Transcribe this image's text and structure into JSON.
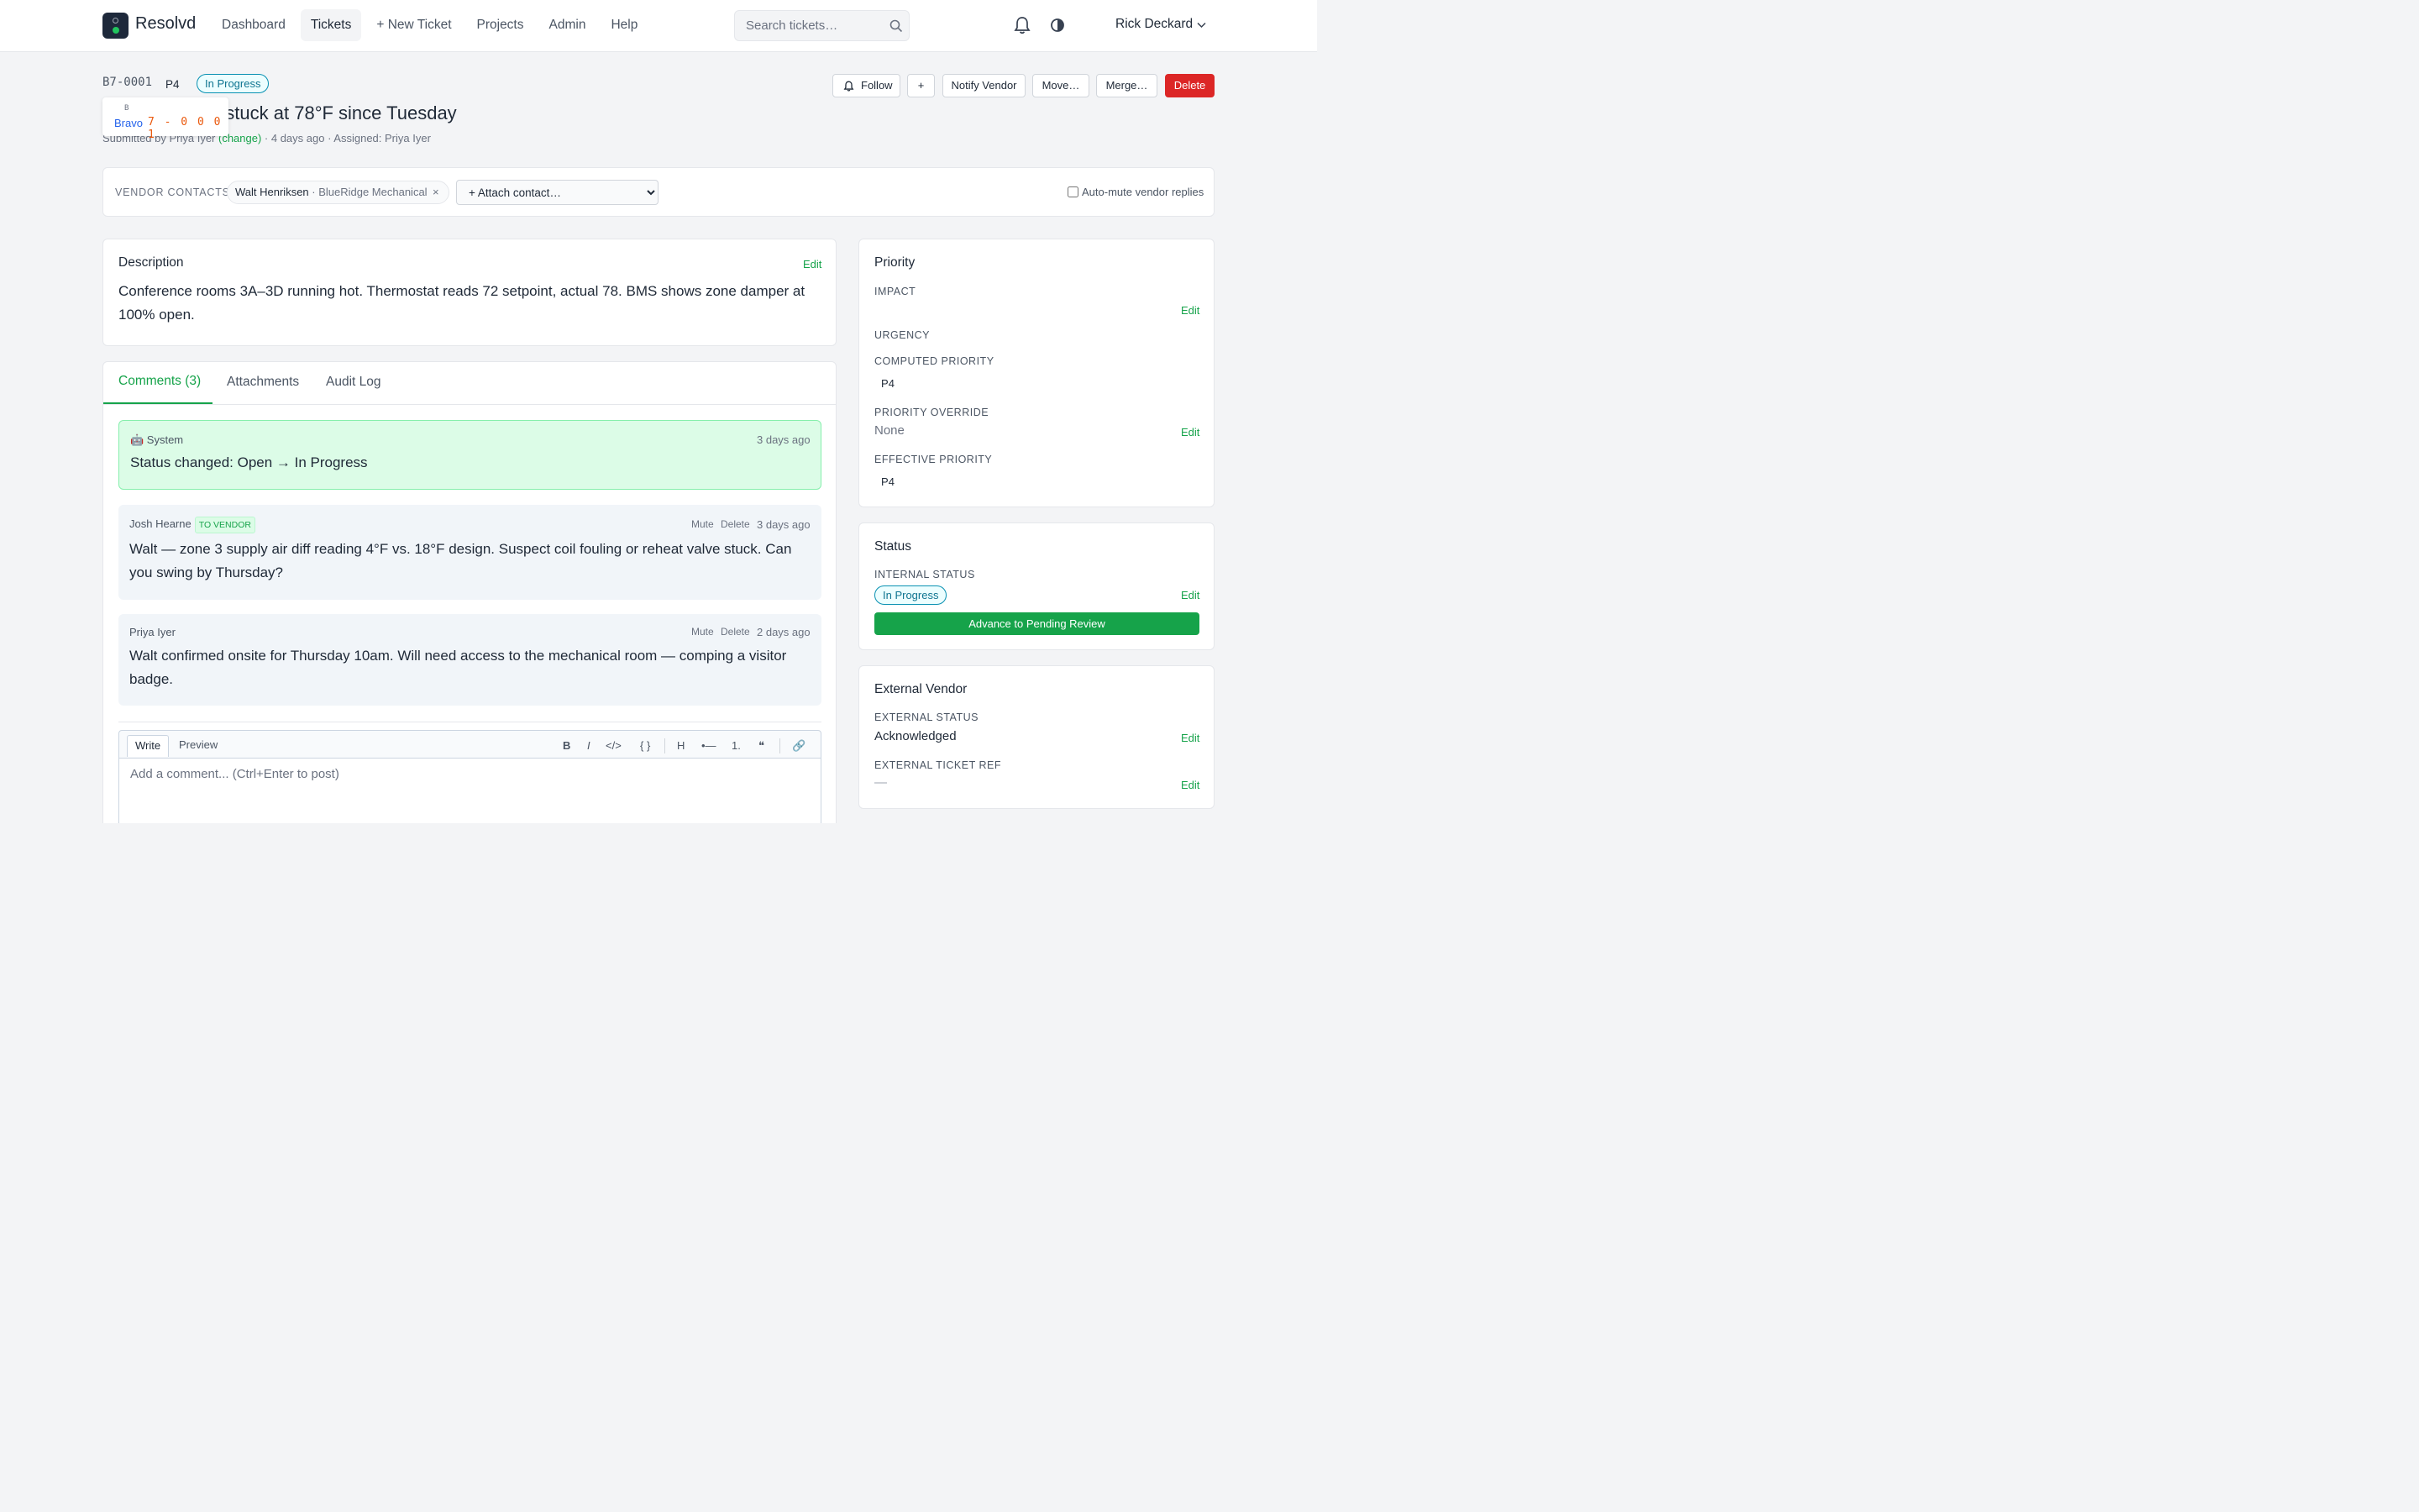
{
  "app": {
    "brand": "Resolvd",
    "user": "Rick Deckard"
  },
  "nav": {
    "links": [
      "Dashboard",
      "Tickets",
      "+ New Ticket",
      "Projects",
      "Admin",
      "Help"
    ]
  },
  "search": {
    "placeholder": "Search tickets…"
  },
  "ticket": {
    "id": "B7-0001",
    "priority": "P4",
    "status": "In Progress",
    "title": "HVAC damper stuck at 78°F since Tuesday",
    "submitted_prefix": "Submitted by Priya Iyer ",
    "change_label": "(change)",
    "submitted_suffix": " · 4 days ago · Assigned: Priya Iyer"
  },
  "tooltip": {
    "line1": "B",
    "word": "Bravo",
    "code": "7 - 0 0 0 1"
  },
  "actions": {
    "follow": "Follow",
    "plus": "+",
    "notify": "Notify Vendor",
    "move": "Move…",
    "merge": "Merge…",
    "delete": "Delete"
  },
  "vendor_contacts": {
    "label": "VENDOR CONTACTS",
    "chip_name": "Walt Henriksen",
    "chip_org": " · BlueRidge Mechanical",
    "chip_remove": "×",
    "attach_option": "+ Attach contact…",
    "automute": "Auto-mute vendor replies"
  },
  "description": {
    "title": "Description",
    "edit": "Edit",
    "text": "Conference rooms 3A–3D running hot. Thermostat reads 72 setpoint, actual 78. BMS shows zone damper at 100% open."
  },
  "tabs": [
    "Comments (3)",
    "Attachments",
    "Audit Log"
  ],
  "comments": [
    {
      "author": "🤖 System",
      "time": "3 days ago",
      "body": "Status changed: Open → In Progress"
    },
    {
      "author": "Josh Hearne",
      "badge": "TO VENDOR",
      "mute": "Mute",
      "delete": "Delete",
      "time": "3 days ago",
      "body": "Walt — zone 3 supply air diff reading 4°F vs. 18°F design. Suspect coil fouling or reheat valve stuck. Can you swing by Thursday?"
    },
    {
      "author": "Priya Iyer",
      "mute": "Mute",
      "delete": "Delete",
      "time": "2 days ago",
      "body": "Walt confirmed onsite for Thursday 10am. Will need access to the mechanical room — comping a visitor badge."
    }
  ],
  "editor": {
    "write": "Write",
    "preview": "Preview",
    "tools": [
      "B",
      "I",
      "</>",
      "{ }",
      "H",
      "•—",
      "1.",
      "❝",
      "🔗"
    ],
    "placeholder": "Add a comment... (Ctrl+Enter to post)"
  },
  "priority_panel": {
    "title": "Priority",
    "impact_label": "IMPACT",
    "urgency_label": "URGENCY",
    "computed_label": "COMPUTED PRIORITY",
    "computed_value": "P4",
    "override_label": "PRIORITY OVERRIDE",
    "override_value": "None",
    "effective_label": "EFFECTIVE PRIORITY",
    "effective_value": "P4",
    "edit": "Edit"
  },
  "status_panel": {
    "title": "Status",
    "internal_label": "INTERNAL STATUS",
    "internal_value": "In Progress",
    "advance": "Advance to Pending Review",
    "edit": "Edit"
  },
  "vendor_panel": {
    "title": "External Vendor",
    "ext_status_label": "EXTERNAL STATUS",
    "ext_status_value": "Acknowledged",
    "ext_ref_label": "EXTERNAL TICKET REF",
    "ext_ref_value": "—",
    "edit": "Edit"
  },
  "colors": {
    "accent": "#16a34a",
    "danger": "#dc2626",
    "status": "#0891b2"
  }
}
